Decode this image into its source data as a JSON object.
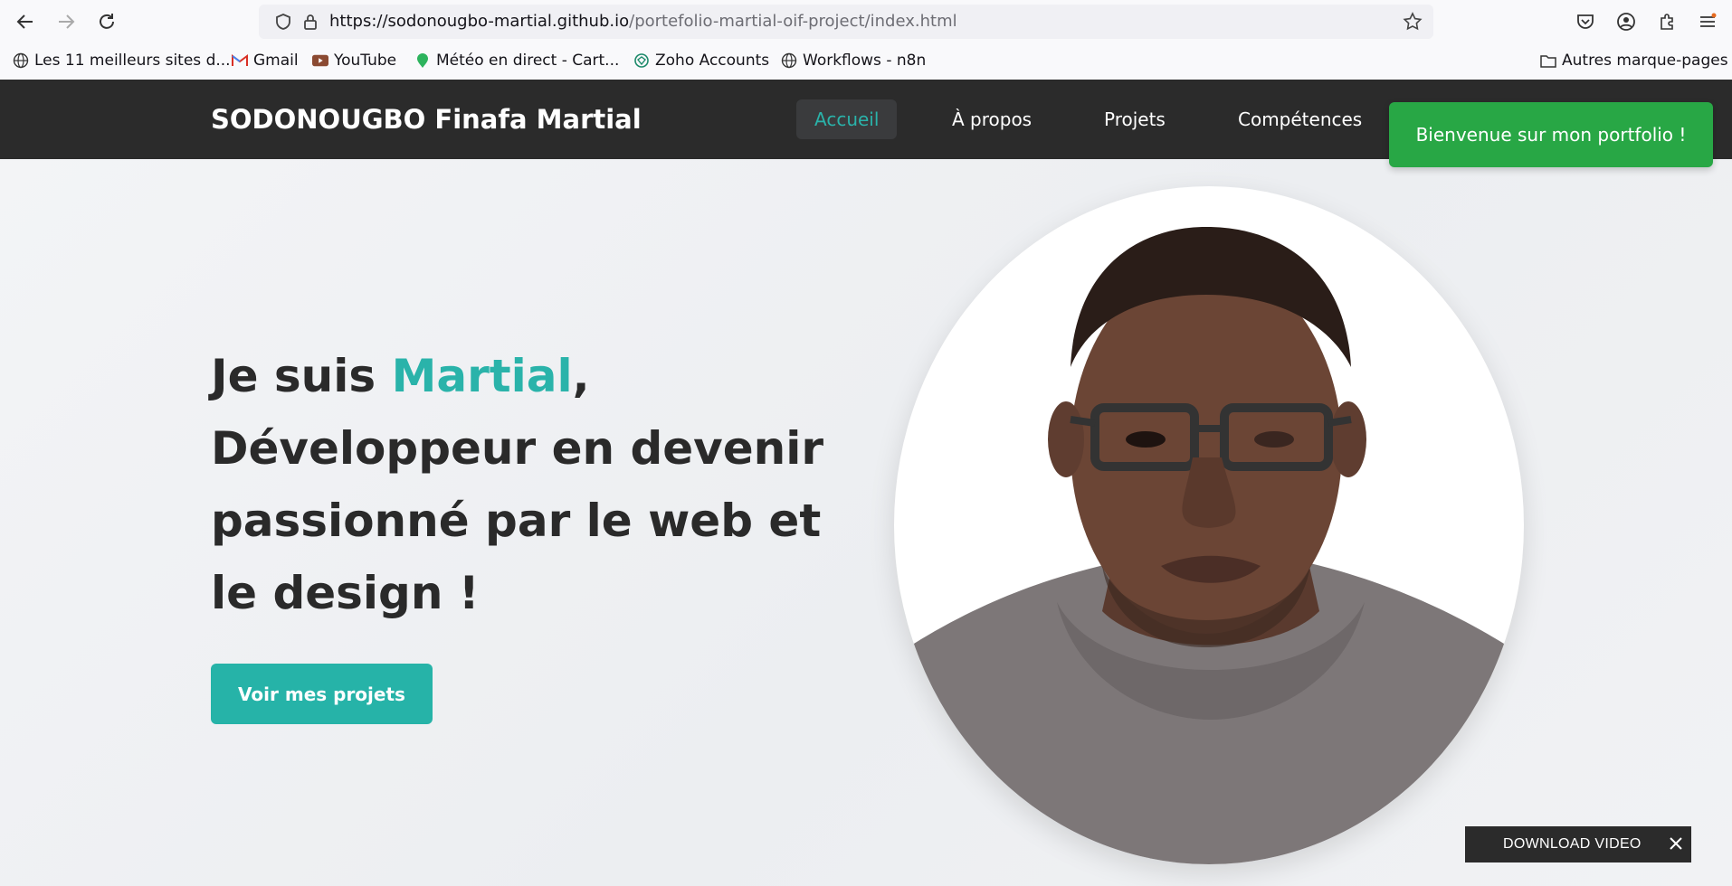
{
  "browser": {
    "url_domain": "https://sodonougbo-martial.github.io",
    "url_path": "/portefolio-martial-oif-project/index.html"
  },
  "bookmarks": [
    {
      "label": "Les 11 meilleurs sites d...",
      "icon": "globe-icon"
    },
    {
      "label": "Gmail",
      "icon": "gmail-icon"
    },
    {
      "label": "YouTube",
      "icon": "youtube-icon"
    },
    {
      "label": "Météo en direct - Cart...",
      "icon": "weather-icon"
    },
    {
      "label": "Zoho Accounts",
      "icon": "zoho-icon"
    },
    {
      "label": "Workflows - n8n",
      "icon": "globe-icon"
    }
  ],
  "other_bookmarks": "Autres marque-pages",
  "site": {
    "brand": "SODONOUGBO Finafa Martial",
    "menu": [
      "Accueil",
      "À propos",
      "Projets",
      "Compétences"
    ],
    "toast": "Bienvenue sur mon portfolio !"
  },
  "hero": {
    "line1_prefix": "Je suis ",
    "name": "Martial",
    "line1_suffix": ",",
    "rest": "Développeur en devenir passionné par le web et le design !",
    "cta": "Voir mes projets"
  },
  "download_video": "DOWNLOAD VIDEO",
  "colors": {
    "accent": "#2ab3aa",
    "header": "#2b2b2b",
    "toast": "#28a745"
  }
}
